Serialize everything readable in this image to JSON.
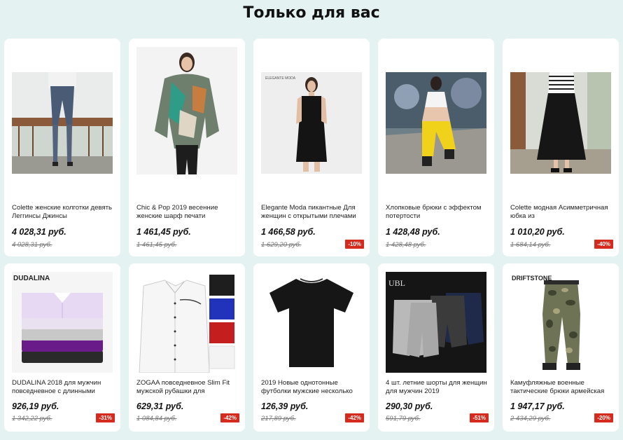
{
  "section": {
    "title": "Только для вас"
  },
  "products": [
    {
      "name": "Colette женские колготки девять Леггинсы Джинсы",
      "price": "4 028,31 руб.",
      "old_price": "4 028,31 руб.",
      "discount": ""
    },
    {
      "name": "Chic & Pop 2019 весенние женские шарф печати",
      "price": "1 461,45 руб.",
      "old_price": "1 461,45 руб.",
      "discount": ""
    },
    {
      "name": "Elegante Moda пикантные Для женщин с открытыми плечами",
      "price": "1 466,58 руб.",
      "old_price": "1 629,20 руб.",
      "discount": "-10%",
      "brand": "ELEGANTE MODA"
    },
    {
      "name": "Хлопковые брюки с эффектом потертости",
      "price": "1 428,48 руб.",
      "old_price": "1 428,48 руб.",
      "discount": ""
    },
    {
      "name": "Colette модная Асимметричная юбка из",
      "price": "1 010,20 руб.",
      "old_price": "1 684,14 руб.",
      "discount": "-40%"
    },
    {
      "name": "DUDALINA 2018 для мужчин повседневное с длинными",
      "price": "926,19 руб.",
      "old_price": "1 342,22 руб.",
      "discount": "-31%",
      "brand": "DUDALINA"
    },
    {
      "name": "ZOGAA повседневное Slim Fit мужской рубашки для",
      "price": "629,31 руб.",
      "old_price": "1 084,84 руб.",
      "discount": "-42%"
    },
    {
      "name": "2019 Новые однотонные футболки мужские несколько",
      "price": "126,39 руб.",
      "old_price": "217,89 руб.",
      "discount": "-42%"
    },
    {
      "name": "4 шт. летние шорты для женщин для мужчин 2019",
      "price": "290,30 руб.",
      "old_price": "591,79 руб.",
      "discount": "-51%",
      "brand": "UBL"
    },
    {
      "name": "Камуфляжные военные тактические брюки армейская",
      "price": "1 947,17 руб.",
      "old_price": "2 434,29 руб.",
      "discount": "-20%",
      "brand": "DRIFTSTONE"
    }
  ]
}
